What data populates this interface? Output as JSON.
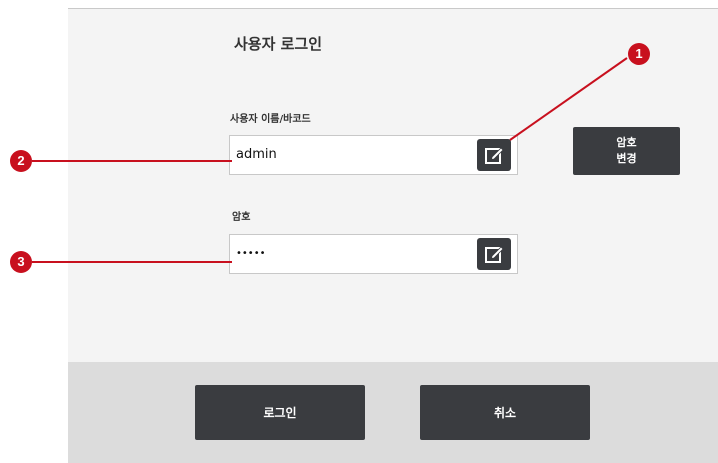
{
  "title": "사용자 로그인",
  "username": {
    "label": "사용자 이름/바코드",
    "value": "admin",
    "edit_icon": "edit-icon"
  },
  "password": {
    "label": "암호",
    "value": "•••••",
    "edit_icon": "edit-icon"
  },
  "change_password_button": {
    "line1": "암호",
    "line2": "변경"
  },
  "footer": {
    "login_label": "로그인",
    "cancel_label": "취소"
  },
  "callouts": [
    "1",
    "2",
    "3"
  ],
  "colors": {
    "button_dark": "#3a3c40",
    "callout_red": "#c8101e",
    "footer_bg": "#dcdcdc"
  }
}
